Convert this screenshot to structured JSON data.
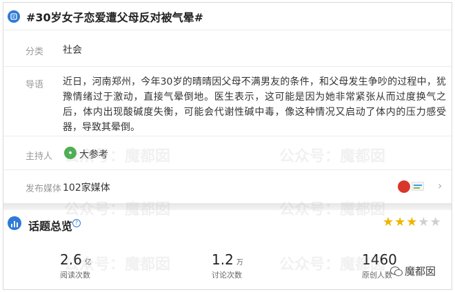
{
  "topic": {
    "title": "#30岁女子恋爱遭父母反对被气晕#"
  },
  "category": {
    "label": "分类",
    "value": "社会"
  },
  "lead": {
    "label": "导语",
    "text": "近日，河南郑州，今年30岁的晴晴因父母不满男友的条件，和父母发生争吵的过程中，犹豫情绪过于激动，直接气晕倒地。医生表示，这可能是因为她非常紧张从而过度换气之后，体内出现酸碱度失衡，可能会代谢性碱中毒，像这种情况又启动了体内的压力感受器，导致其晕倒。"
  },
  "host": {
    "label": "主持人",
    "name": "大参考"
  },
  "media": {
    "label": "发布媒体",
    "value": "102家媒体"
  },
  "overview": {
    "title": "话题总览",
    "help": "?",
    "rating": 3,
    "rating_max": 5,
    "stats": [
      {
        "value": "2.6",
        "unit": "亿",
        "label": "阅读次数"
      },
      {
        "value": "1.2",
        "unit": "万",
        "label": "讨论次数"
      },
      {
        "value": "1460",
        "unit": "",
        "label": "原创人数"
      }
    ]
  },
  "watermark": {
    "text": "公众号：魔都囡",
    "corner_text": "魔都囡"
  },
  "colors": {
    "accent": "#2f7ad8",
    "star_on": "#f0b400",
    "star_off": "#cfcfcf"
  },
  "icons": [
    "topic-icon",
    "host-avatar-icon",
    "media-logo-icon",
    "chevron-right-icon",
    "chart-icon",
    "help-icon",
    "star-icon",
    "wechat-icon"
  ]
}
